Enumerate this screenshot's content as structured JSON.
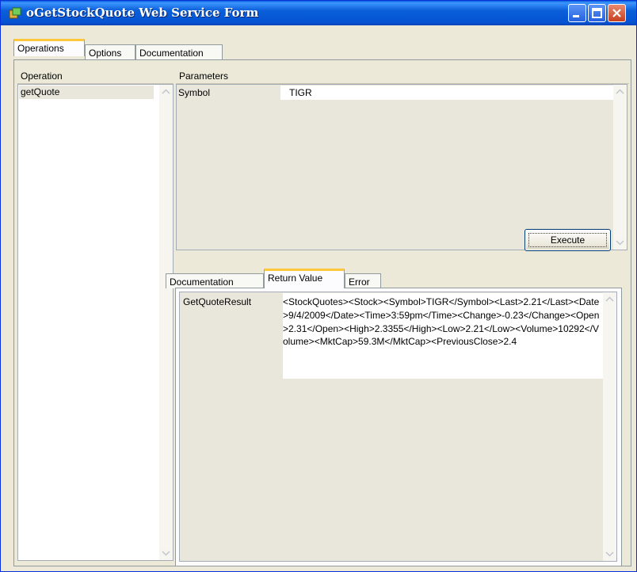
{
  "window": {
    "title": "oGetStockQuote Web Service Form"
  },
  "main_tabs": [
    {
      "label": "Operations",
      "active": true
    },
    {
      "label": "Options",
      "active": false
    },
    {
      "label": "Documentation",
      "active": false
    }
  ],
  "operations": {
    "header": "Operation",
    "items": [
      "getQuote"
    ],
    "selected": "getQuote"
  },
  "parameters": {
    "header": "Parameters",
    "rows": [
      {
        "name": "Symbol",
        "value": "TIGR"
      }
    ]
  },
  "execute_label": "Execute",
  "result_tabs": [
    {
      "label": "Documentation",
      "active": false
    },
    {
      "label": "Return Value",
      "active": true
    },
    {
      "label": "Error",
      "active": false
    }
  ],
  "return_value": {
    "name": "GetQuoteResult",
    "value": "<StockQuotes><Stock><Symbol>TIGR</Symbol><Last>2.21</Last><Date>9/4/2009</Date><Time>3:59pm</Time><Change>-0.23</Change><Open>2.31</Open><High>2.3355</High><Low>2.21</Low><Volume>10292</Volume><MktCap>59.3M</MktCap><PreviousClose>2.4"
  },
  "colors": {
    "titlebar": "#0a5fd8",
    "selection": "#e9e7dc",
    "tab_accent": "#ffc83c"
  }
}
